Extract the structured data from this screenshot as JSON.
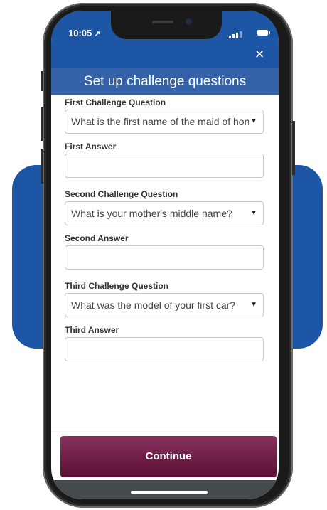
{
  "status_bar": {
    "time": "10:05",
    "location_glyph": "↗"
  },
  "header": {
    "close_glyph": "✕",
    "title": "Set up challenge questions"
  },
  "form": {
    "q1": {
      "label": "First Challenge Question",
      "selected": "What is the first name of the maid of honor at your wedding?"
    },
    "a1": {
      "label": "First Answer",
      "value": ""
    },
    "q2": {
      "label": "Second Challenge Question",
      "selected": "What is your mother's middle name?"
    },
    "a2": {
      "label": "Second Answer",
      "value": ""
    },
    "q3": {
      "label": "Third Challenge Question",
      "selected": "What was the model of your first car?"
    },
    "a3": {
      "label": "Third Answer",
      "value": ""
    },
    "dropdown_glyph": "▼"
  },
  "footer": {
    "continue_label": "Continue"
  },
  "colors": {
    "header_blue": "#1e56a6",
    "title_blue": "#3362a8",
    "continue_top": "#87325d",
    "continue_bottom": "#5a0f33",
    "background_panel": "#1e56a6"
  },
  "icons": {
    "close": "close-icon",
    "location": "location-arrow-icon",
    "signal": "cellular-signal-icon",
    "battery": "battery-icon",
    "dropdown": "chevron-down-icon"
  }
}
